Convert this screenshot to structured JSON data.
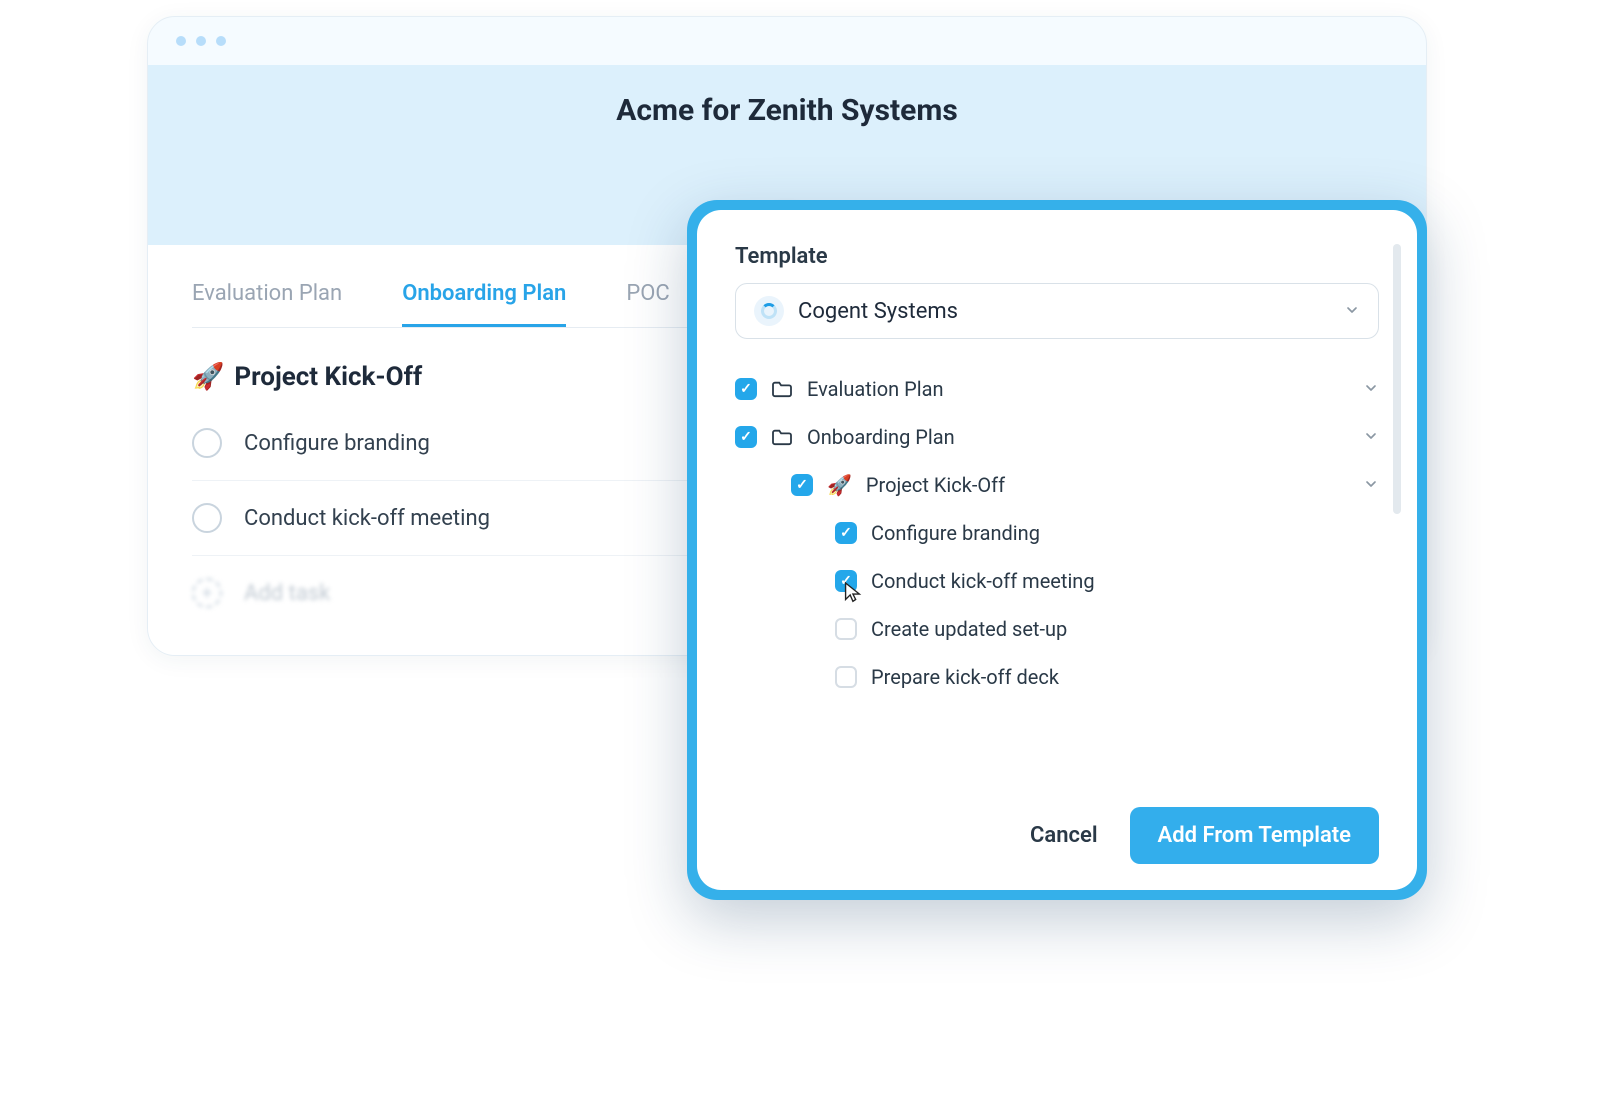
{
  "page_title": "Acme for Zenith Systems",
  "tabs": [
    {
      "label": "Evaluation Plan",
      "active": false
    },
    {
      "label": "Onboarding Plan",
      "active": true
    },
    {
      "label": "POC",
      "active": false
    }
  ],
  "section": {
    "emoji": "🚀",
    "title": "Project Kick-Off",
    "tasks": [
      "Configure branding",
      "Conduct kick-off meeting"
    ],
    "add_task_label": "Add task"
  },
  "modal": {
    "label": "Template",
    "selected_template": "Cogent Systems",
    "tree": {
      "plans": [
        {
          "label": "Evaluation Plan",
          "checked": true
        },
        {
          "label": "Onboarding Plan",
          "checked": true
        }
      ],
      "subgroup": {
        "emoji": "🚀",
        "label": "Project Kick-Off",
        "checked": true
      },
      "items": [
        {
          "label": "Configure branding",
          "checked": true
        },
        {
          "label": "Conduct kick-off meeting",
          "checked": true
        },
        {
          "label": "Create updated set-up",
          "checked": false
        },
        {
          "label": "Prepare kick-off deck",
          "checked": false
        }
      ]
    },
    "cancel_label": "Cancel",
    "submit_label": "Add From Template"
  }
}
